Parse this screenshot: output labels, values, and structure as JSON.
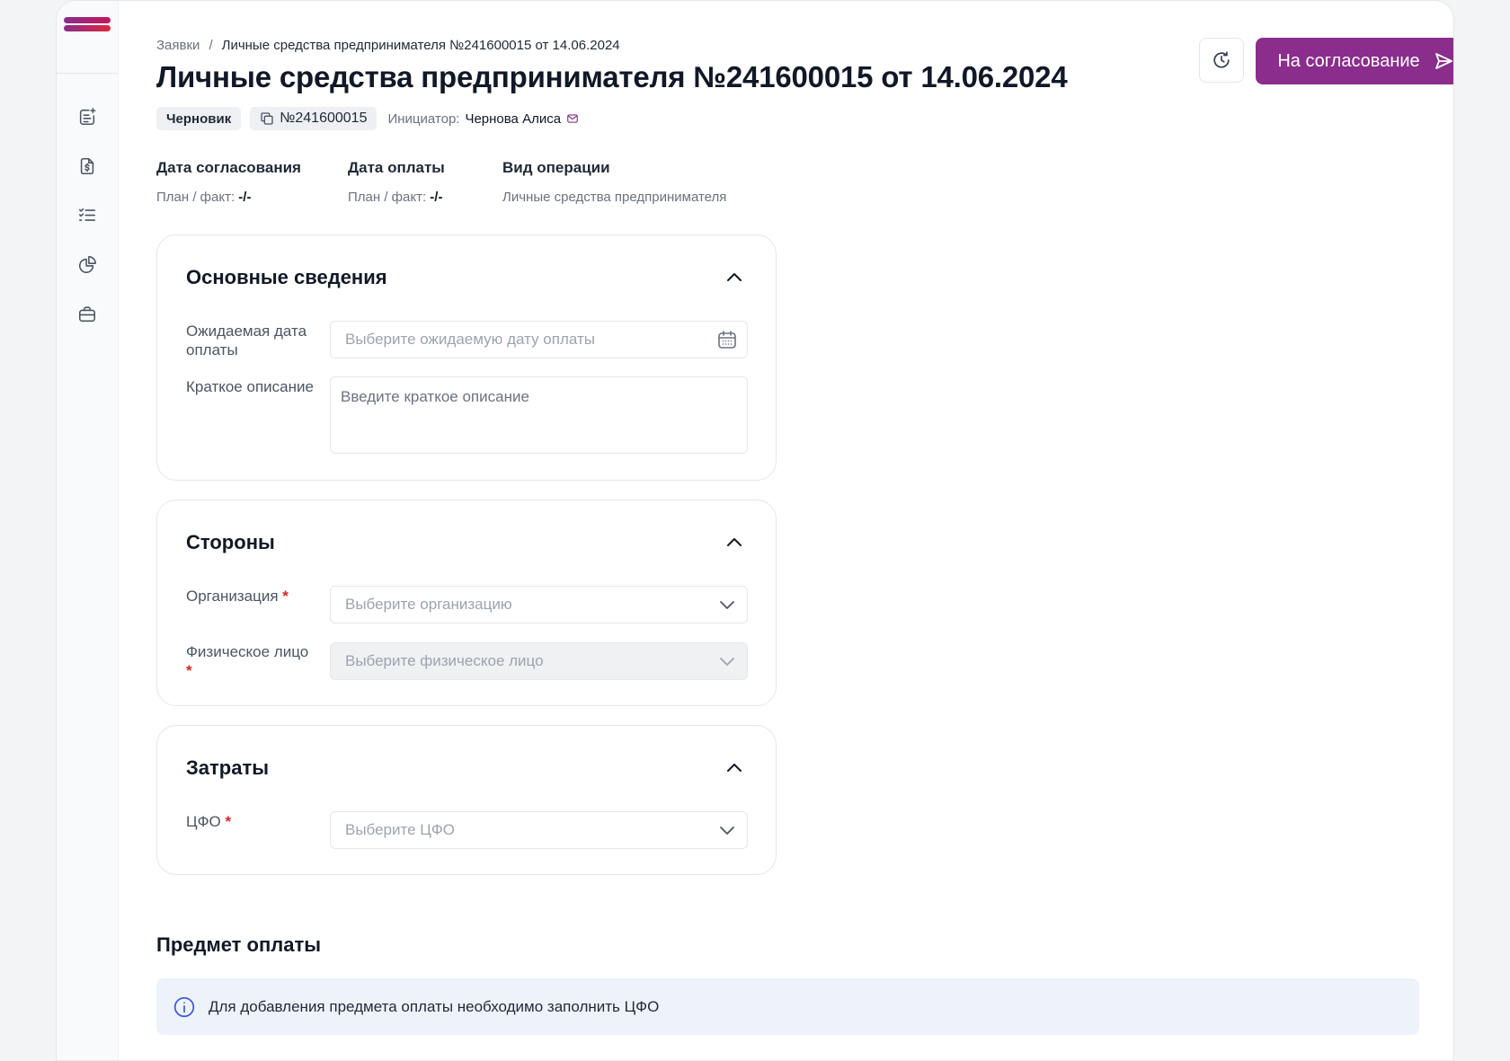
{
  "colors": {
    "accent": "#8a2d8c",
    "logo_top": "#8a2d8c",
    "logo_bottom": "#e0263a",
    "required": "#dc2626",
    "banner_bg": "#eef2fb"
  },
  "sidebar": {
    "items": [
      {
        "icon": "request-list-icon"
      },
      {
        "icon": "invoice-dollar-icon"
      },
      {
        "icon": "checklist-icon"
      },
      {
        "icon": "pie-chart-icon"
      },
      {
        "icon": "briefcase-icon"
      }
    ]
  },
  "breadcrumb": {
    "root": "Заявки",
    "separator": "/",
    "current": "Личные средства предпринимателя №241600015 от 14.06.2024"
  },
  "page": {
    "title": "Личные средства предпринимателя №241600015 от 14.06.2024",
    "status": "Черновик",
    "number": "№241600015",
    "initiator_label": "Инициатор:",
    "initiator_name": "Чернова Алиса"
  },
  "actions": {
    "history_icon": "history-clock-icon",
    "approve_label": "На согласование",
    "approve_icon": "send-icon"
  },
  "summary": [
    {
      "title": "Дата согласования",
      "prefix": "План / факт:",
      "value": "-/-"
    },
    {
      "title": "Дата оплаты",
      "prefix": "План / факт:",
      "value": "-/-"
    },
    {
      "title": "Вид операции",
      "prefix": "Личные средства предпринимателя",
      "value": ""
    }
  ],
  "sections": {
    "basic": {
      "title": "Основные сведения",
      "payment_date_label": "Ожидаемая дата оплаты",
      "payment_date_placeholder": "Выберите ожидаемую дату оплаты",
      "description_label": "Краткое описание",
      "description_placeholder": "Введите краткое описание"
    },
    "parties": {
      "title": "Стороны",
      "organization_label": "Организация",
      "organization_placeholder": "Выберите организацию",
      "person_label": "Физическое лицо",
      "person_placeholder": "Выберите физическое лицо",
      "required_mark": "*"
    },
    "costs": {
      "title": "Затраты",
      "cfo_label": "ЦФО",
      "cfo_placeholder": "Выберите ЦФО",
      "required_mark": "*"
    }
  },
  "payment_subject": {
    "title": "Предмет оплаты",
    "notice": "Для добавления предмета оплаты необходимо заполнить ЦФО"
  }
}
